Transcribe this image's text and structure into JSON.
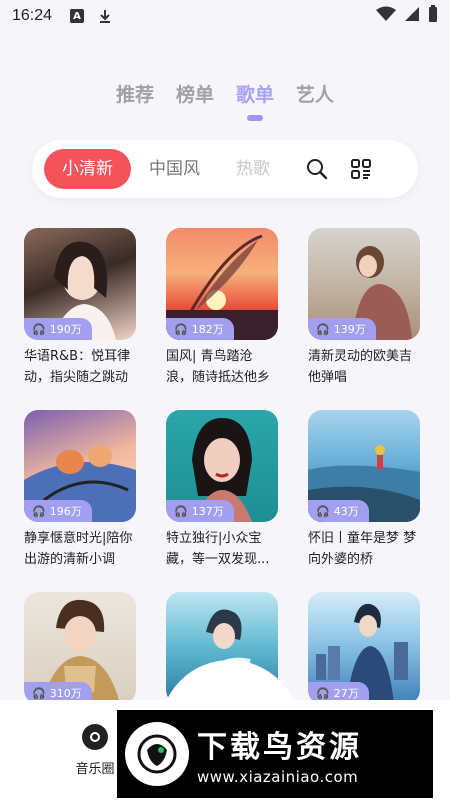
{
  "status": {
    "time": "16:24"
  },
  "top_tabs": [
    {
      "label": "推荐",
      "active": false
    },
    {
      "label": "榜单",
      "active": false
    },
    {
      "label": "歌单",
      "active": true
    },
    {
      "label": "艺人",
      "active": false
    }
  ],
  "filters": {
    "chips": [
      {
        "label": "小清新",
        "active": true
      },
      {
        "label": "中国风",
        "active": false
      },
      {
        "label": "热歌",
        "active": false
      }
    ],
    "search_icon": "search-icon",
    "grid_icon": "grid-icon"
  },
  "playlists": [
    {
      "plays": "190万",
      "title": "华语R&B：悦耳律动，指尖随之跳动"
    },
    {
      "plays": "182万",
      "title": "国风| 青鸟踏沧浪，随诗抵达他乡"
    },
    {
      "plays": "139万",
      "title": "清新灵动的欧美吉他弹唱"
    },
    {
      "plays": "196万",
      "title": "静享惬意时光|陪你出游的清新小调"
    },
    {
      "plays": "137万",
      "title": "特立独行|小众宝藏，等一双发现..."
    },
    {
      "plays": "43万",
      "title": "怀旧丨童年是梦 梦向外婆的桥"
    },
    {
      "plays": "310万",
      "title": ""
    },
    {
      "plays": "",
      "title": ""
    },
    {
      "plays": "27万",
      "title": ""
    }
  ],
  "bottom_nav": {
    "items": [
      {
        "label": "音乐圈",
        "icon": "music-disc-icon"
      }
    ]
  },
  "watermark": {
    "brand": "下载鸟资源",
    "url": "www.xiazainiao.com"
  },
  "colors": {
    "accent": "#f5535c",
    "tab_active": "#a8a3f2",
    "badge": "#a39ff0"
  }
}
